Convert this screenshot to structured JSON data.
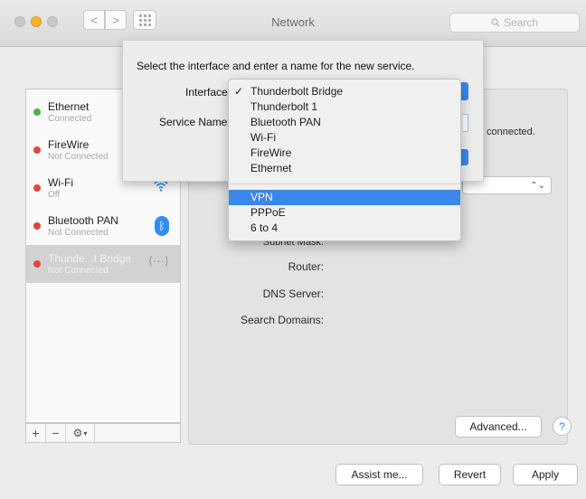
{
  "window": {
    "title": "Network"
  },
  "toolbar": {
    "search_placeholder": "Search",
    "back": "<",
    "forward": ">"
  },
  "sidebar": {
    "services": [
      {
        "name": "Ethernet",
        "status": "Connected",
        "dot": "#45b545"
      },
      {
        "name": "FireWire",
        "status": "Not Connected",
        "dot": "#e5443f"
      },
      {
        "name": "Wi-Fi",
        "status": "Off",
        "dot": "#e5443f",
        "icon": "wifi-icon"
      },
      {
        "name": "Bluetooth PAN",
        "status": "Not Connected",
        "dot": "#e5443f",
        "icon": "bluetooth-icon"
      },
      {
        "name": "Thunde...t Bridge",
        "status": "Not Connected",
        "dot": "#e5443f",
        "icon": "thunderbolt-bridge-icon",
        "selected": true
      }
    ],
    "footer": {
      "add": "+",
      "remove": "−",
      "gear": "⚙"
    }
  },
  "main": {
    "status_text": "connected.",
    "labels": {
      "subnet_mask": "Subnet Mask:",
      "router": "Router:",
      "dns_server": "DNS Server:",
      "search_domains": "Search Domains:"
    },
    "advanced_button": "Advanced...",
    "help_button": "?"
  },
  "sheet": {
    "title": "Select the interface and enter a name for the new service.",
    "interface_label": "Interface",
    "service_name_label": "Service Name"
  },
  "interface_menu": {
    "items": [
      "Thunderbolt Bridge",
      "Thunderbolt 1",
      "Bluetooth PAN",
      "Wi-Fi",
      "FireWire",
      "Ethernet"
    ],
    "items2": [
      "VPN",
      "PPPoE",
      "6 to 4"
    ],
    "checked": "Thunderbolt Bridge",
    "highlighted": "VPN",
    "check_glyph": "✓"
  },
  "footer_buttons": {
    "assist": "Assist me...",
    "revert": "Revert",
    "apply": "Apply"
  },
  "colors": {
    "accent": "#3b86e8",
    "connected": "#45b545",
    "disconnected": "#e5443f"
  }
}
